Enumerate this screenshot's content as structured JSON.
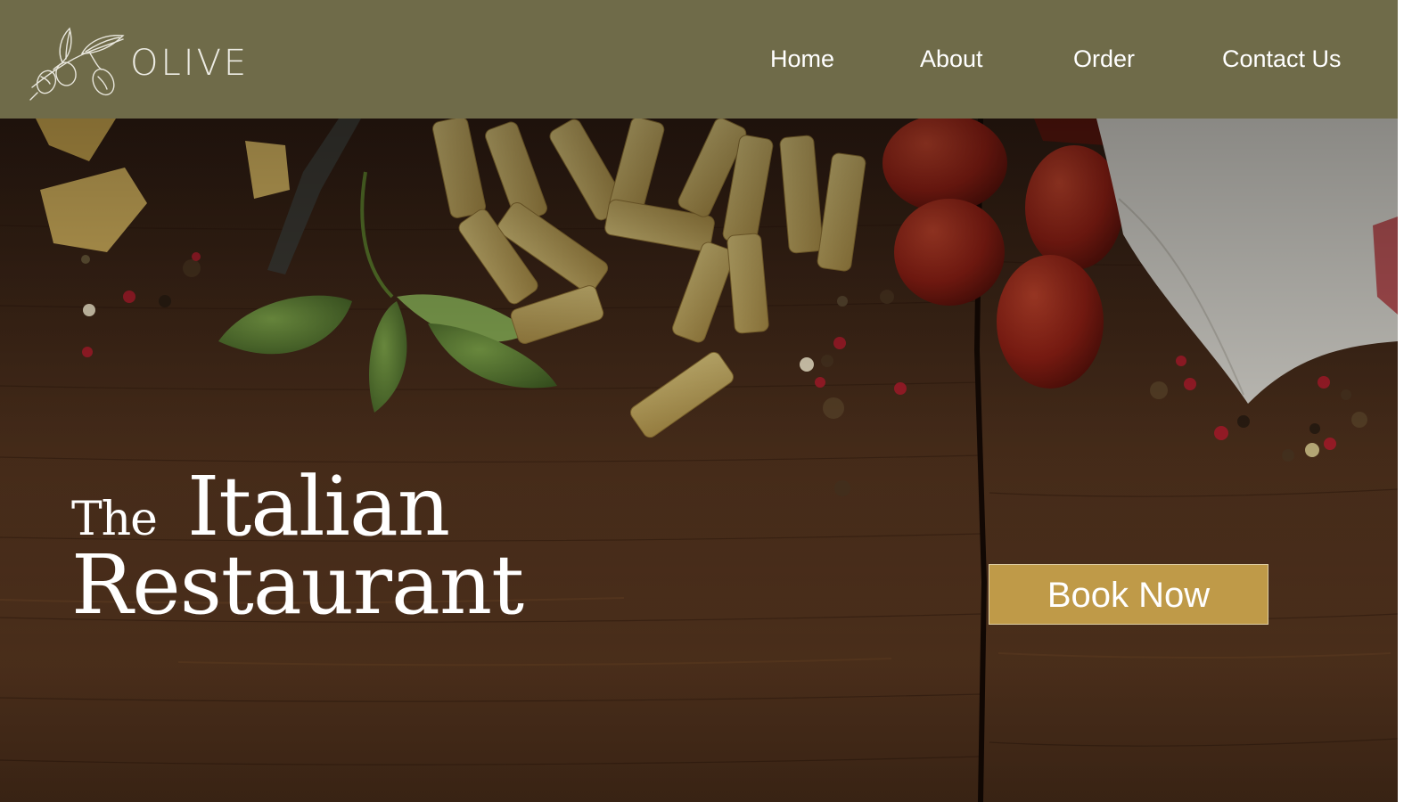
{
  "brand": {
    "name": "OLIVE",
    "logo_icon": "olive-branch-icon"
  },
  "nav": {
    "items": [
      {
        "label": "Home"
      },
      {
        "label": "About"
      },
      {
        "label": "Order"
      },
      {
        "label": "Contact Us"
      }
    ]
  },
  "hero": {
    "title_small": "The",
    "title_large": "Italian",
    "title_line2": "Restaurant",
    "cta_label": "Book Now",
    "background_image": "wooden-table-with-pasta-basil-tomatoes"
  },
  "colors": {
    "header_bg": "#6f6b49",
    "cta_bg": "#bf9a48",
    "text_light": "#ffffff",
    "wood_dark": "#3a2416"
  }
}
